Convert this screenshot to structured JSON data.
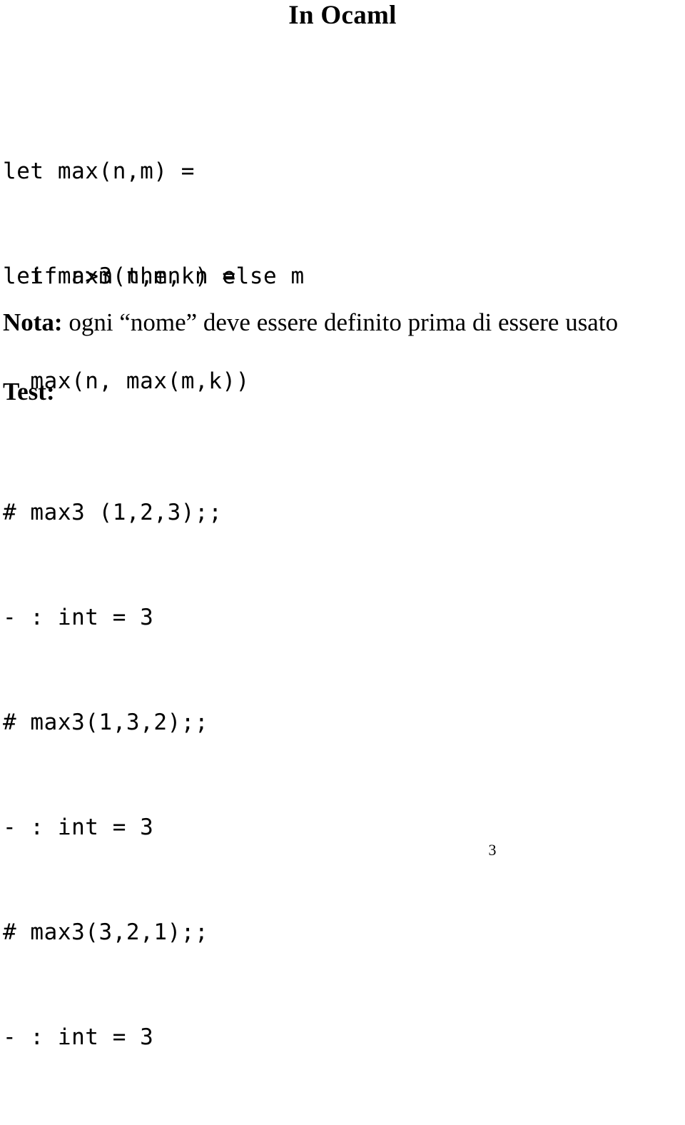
{
  "page": {
    "title": "In Ocaml",
    "background_color": "#ffffff",
    "text_color": "#000000",
    "page_number": "3"
  },
  "code_blocks": [
    {
      "name": "max-definition",
      "lines": [
        "let max(n,m) =",
        "  if n>m then n else m"
      ]
    },
    {
      "name": "max3-definition",
      "lines": [
        "let max3(n,m,k) =",
        "  max(n, max(m,k))"
      ]
    },
    {
      "name": "toplevel-session",
      "lines": [
        "# max3 (1,2,3);;",
        "- : int = 3",
        "# max3(1,3,2);;",
        "- : int = 3",
        "# max3(3,2,1);;",
        "- : int = 3"
      ]
    }
  ],
  "nota": {
    "lead": "Nota:",
    "body": " ogni “nome” deve essere definito prima di essere usato"
  },
  "test": {
    "heading": "Test:"
  }
}
